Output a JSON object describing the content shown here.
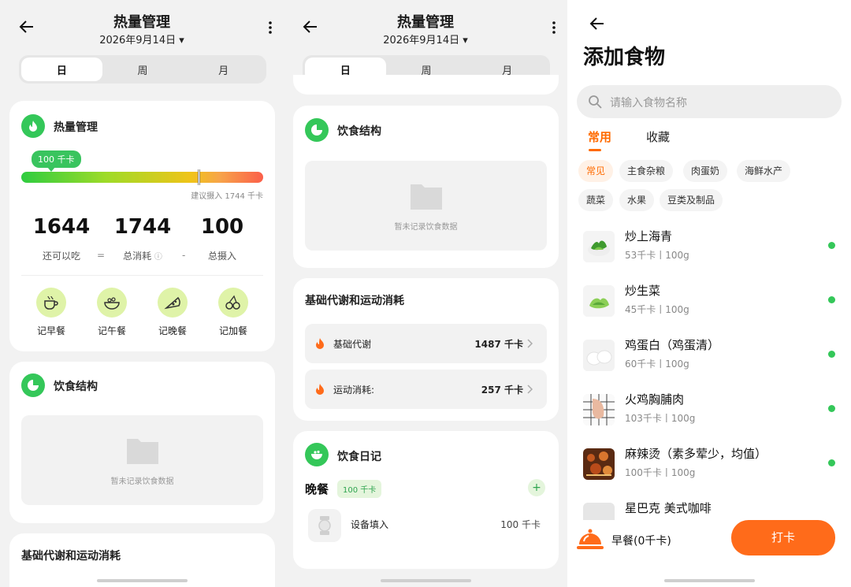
{
  "colors": {
    "green": "#34c759",
    "orange": "#ff6b1a",
    "bg": "#f2f2f2"
  },
  "screen1": {
    "header": {
      "title": "热量管理",
      "date": "2026年9月14日"
    },
    "tabs": [
      "日",
      "周",
      "月"
    ],
    "calorie_card": {
      "title": "热量管理",
      "intake_pill": "100 千卡",
      "intake_fraction": 0.05,
      "target_marker_fraction": 0.73,
      "suggest": "建议摄入 1744 千卡",
      "stats": [
        {
          "value": "1644",
          "label": "还可以吃"
        },
        {
          "value": "1744",
          "label": "总消耗"
        },
        {
          "value": "100",
          "label": "总摄入"
        }
      ],
      "ops": [
        "=",
        "-"
      ],
      "meals": [
        {
          "label": "记早餐",
          "icon": "coffee-cup-icon"
        },
        {
          "label": "记午餐",
          "icon": "rice-bowl-icon"
        },
        {
          "label": "记晚餐",
          "icon": "pizza-slice-icon"
        },
        {
          "label": "记加餐",
          "icon": "cherries-icon"
        }
      ]
    },
    "diet_card": {
      "title": "饮食结构",
      "empty_text": "暂未记录饮食数据"
    },
    "bmr_card": {
      "title": "基础代谢和运动消耗"
    }
  },
  "screen2": {
    "header": {
      "title": "热量管理",
      "date": "2026年9月14日"
    },
    "tabs": [
      "日",
      "周",
      "月"
    ],
    "diet_card": {
      "title": "饮食结构",
      "empty_text": "暂未记录饮食数据"
    },
    "bmr_card": {
      "title": "基础代谢和运动消耗",
      "rows": [
        {
          "label": "基础代谢",
          "value": "1487 千卡"
        },
        {
          "label": "运动消耗:",
          "value": "257 千卡"
        }
      ]
    },
    "diary_card": {
      "title": "饮食日记",
      "meal": "晚餐",
      "meal_badge": "100 千卡",
      "plus": "+",
      "entry": {
        "name": "设备填入",
        "value": "100 千卡"
      }
    }
  },
  "screen3": {
    "title": "添加食物",
    "search_placeholder": "请输入食物名称",
    "tabs": [
      "常用",
      "收藏"
    ],
    "chips": [
      "常见",
      "主食杂粮",
      "肉蛋奶",
      "海鲜水产",
      "蔬菜",
      "水果",
      "豆类及制品"
    ],
    "foods": [
      {
        "name": "炒上海青",
        "cal": "53千卡丨100g"
      },
      {
        "name": "炒生菜",
        "cal": "45千卡丨100g"
      },
      {
        "name": "鸡蛋白（鸡蛋清）",
        "cal": "60千卡丨100g"
      },
      {
        "name": "火鸡胸脯肉",
        "cal": "103千卡丨100g"
      },
      {
        "name": "麻辣烫（素多荤少，均值）",
        "cal": "100千卡丨100g"
      },
      {
        "name": "星巴克 美式咖啡",
        "cal": ""
      }
    ],
    "bottom": {
      "meal_text": "早餐(0千卡)",
      "button": "打卡"
    }
  }
}
